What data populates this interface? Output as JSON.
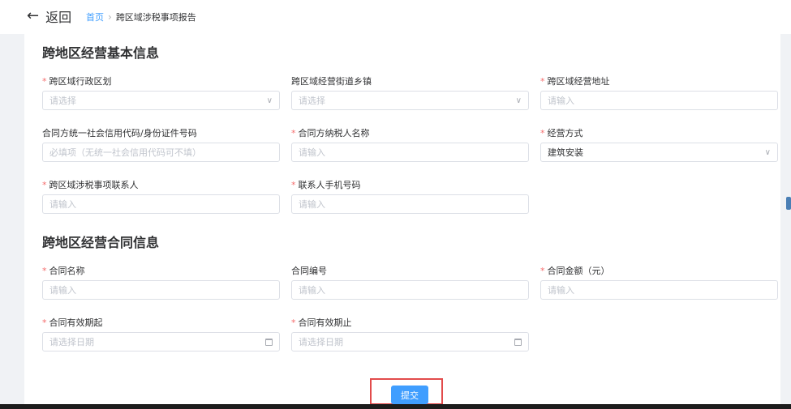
{
  "header": {
    "back_label": "返回",
    "breadcrumb": {
      "home": "首页",
      "separator": "›",
      "current": "跨区域涉税事项报告"
    }
  },
  "basic_section": {
    "title": "跨地区经营基本信息",
    "fields": [
      {
        "label": "跨区域行政区划",
        "required": true,
        "placeholder": "请选择",
        "value": "",
        "type": "select"
      },
      {
        "label": "跨区域经营街道乡镇",
        "required": false,
        "placeholder": "请选择",
        "value": "",
        "type": "select"
      },
      {
        "label": "跨区域经营地址",
        "required": true,
        "placeholder": "请输入",
        "value": "",
        "type": "input"
      },
      {
        "label": "合同方统一社会信用代码/身份证件号码",
        "required": false,
        "placeholder": "必填项（无统一社会信用代码可不填）",
        "value": "",
        "type": "input"
      },
      {
        "label": "合同方纳税人名称",
        "required": true,
        "placeholder": "请输入",
        "value": "",
        "type": "input"
      },
      {
        "label": "经营方式",
        "required": true,
        "placeholder": "",
        "value": "建筑安装",
        "type": "select"
      },
      {
        "label": "跨区域涉税事项联系人",
        "required": true,
        "placeholder": "请输入",
        "value": "",
        "type": "input"
      },
      {
        "label": "联系人手机号码",
        "required": true,
        "placeholder": "请输入",
        "value": "",
        "type": "input"
      }
    ]
  },
  "contract_section": {
    "title": "跨地区经营合同信息",
    "fields": [
      {
        "label": "合同名称",
        "required": true,
        "placeholder": "请输入",
        "value": "",
        "type": "input"
      },
      {
        "label": "合同编号",
        "required": false,
        "placeholder": "请输入",
        "value": "",
        "type": "input"
      },
      {
        "label": "合同金额（元）",
        "required": true,
        "placeholder": "请输入",
        "value": "",
        "type": "input"
      },
      {
        "label": "合同有效期起",
        "required": true,
        "placeholder": "请选择日期",
        "value": "",
        "type": "date"
      },
      {
        "label": "合同有效期止",
        "required": true,
        "placeholder": "请选择日期",
        "value": "",
        "type": "date"
      }
    ]
  },
  "submit_label": "提交",
  "icons": {
    "select": "chevron-down-icon",
    "date": "calendar-icon",
    "back": "arrow-left-icon"
  },
  "colors": {
    "primary": "#409eff",
    "required": "#f56c6c",
    "highlight": "#e24b4b"
  }
}
